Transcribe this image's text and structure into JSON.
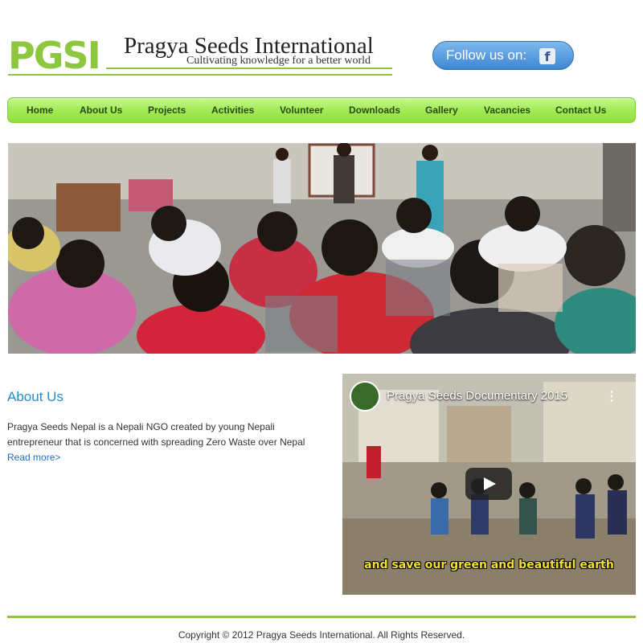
{
  "header": {
    "logo_mark": "PGSI",
    "title": "Pragya Seeds International",
    "tagline": "Cultivating knowledge for a better world",
    "follow_label": "Follow us on:",
    "social_icon": "facebook-icon"
  },
  "nav": {
    "items": [
      "Home",
      "About Us",
      "Projects",
      "Activities",
      "Volunteer",
      "Downloads",
      "Gallery",
      "Vacancies",
      "Contact Us"
    ]
  },
  "about": {
    "title": "About Us",
    "text": "Pragya Seeds Nepal is a Nepali NGO created by young Nepali entrepreneur that is concerned with spreading Zero Waste over Nepal",
    "read_more": "Read more>"
  },
  "video": {
    "title": "Pragya Seeds Documentary 2015",
    "caption": "and save our green and beautiful earth"
  },
  "footer": {
    "copyright": "Copyright © 2012 Pragya Seeds International. All Rights Reserved."
  },
  "colors": {
    "brand_green": "#8dc63f",
    "link_blue": "#2a89c9"
  }
}
